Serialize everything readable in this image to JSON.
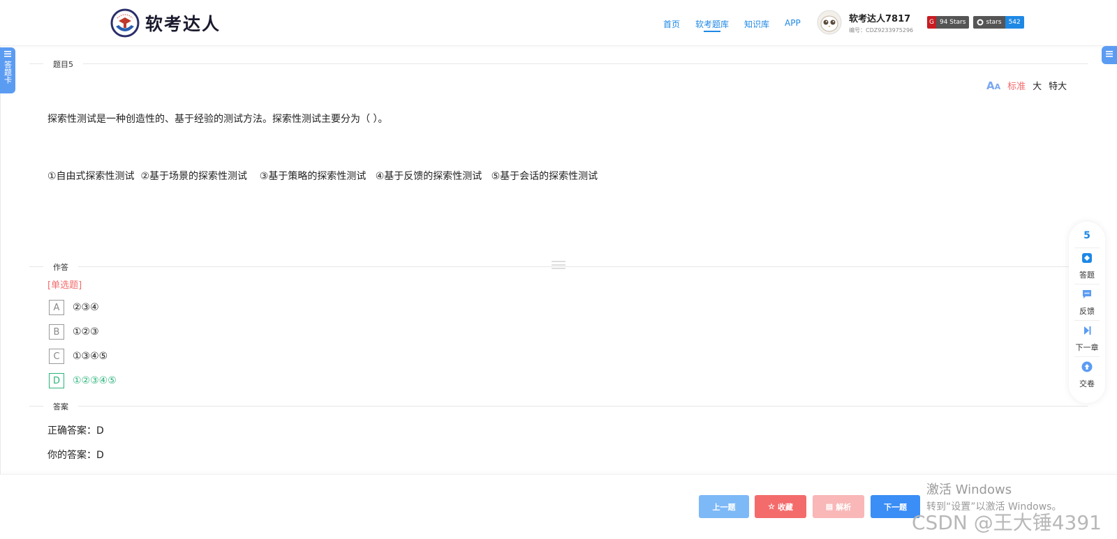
{
  "header": {
    "logo_text": "软考达人",
    "nav": [
      {
        "label": "首页",
        "active": false
      },
      {
        "label": "软考题库",
        "active": true
      },
      {
        "label": "知识库",
        "active": false
      },
      {
        "label": "APP",
        "active": false
      }
    ],
    "user": {
      "name": "软考达人7817",
      "id": "编号：CDZ9233975296"
    },
    "badges": [
      {
        "left": "G",
        "right": "94 Stars"
      },
      {
        "left": "stars",
        "right": "542"
      }
    ]
  },
  "side_tab": {
    "label": "答题卡"
  },
  "sections": {
    "question_label": "题目5",
    "answer_area_label": "作答",
    "answer_label": "答案"
  },
  "font_size": {
    "options": [
      "标准",
      "大",
      "特大"
    ],
    "active": "标准"
  },
  "question": {
    "stem": "探索性测试是一种创造性的、基于经验的测试方法。探索性测试主要分为（ ）。",
    "options_line": "①自由式探索性测试  ②基于场景的探索性测试    ③基于策略的探索性测试   ④基于反馈的探索性测试   ⑤基于会话的探索性测试",
    "type": "[单选题]",
    "choices": [
      {
        "letter": "A",
        "text": "②③④",
        "correct": false
      },
      {
        "letter": "B",
        "text": "①②③",
        "correct": false
      },
      {
        "letter": "C",
        "text": "①③④⑤",
        "correct": false
      },
      {
        "letter": "D",
        "text": "①②③④⑤",
        "correct": true
      }
    ]
  },
  "answer": {
    "correct": "正确答案：D",
    "yours": "你的答案：D"
  },
  "float_bar": {
    "number": "5",
    "items": [
      {
        "label": "答题",
        "icon": "answer-card-icon"
      },
      {
        "label": "反馈",
        "icon": "feedback-icon"
      },
      {
        "label": "下一章",
        "icon": "next-chapter-icon"
      },
      {
        "label": "交卷",
        "icon": "submit-icon"
      }
    ]
  },
  "buttons": {
    "prev": "上一题",
    "favorite": "收藏",
    "analysis": "解析",
    "next": "下一题"
  },
  "watermarks": {
    "windows_line1": "激活 Windows",
    "windows_line2": "转到“设置”以激活 Windows。",
    "csdn": "CSDN @王大锤4391"
  },
  "colors": {
    "primary": "#1e88e5",
    "correct": "#2bb47a",
    "danger": "#f46b6b"
  }
}
